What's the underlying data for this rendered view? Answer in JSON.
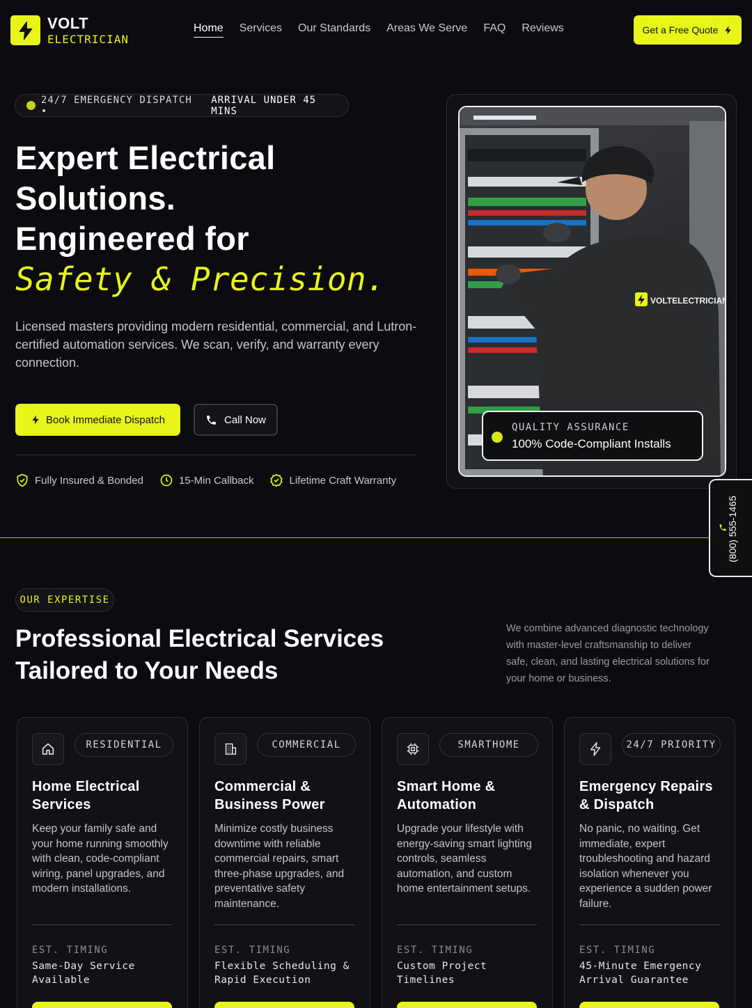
{
  "brand": {
    "name_top": "VOLT",
    "name_bottom": "ELECTRICIAN"
  },
  "nav": {
    "items": [
      {
        "label": "Home",
        "active": true
      },
      {
        "label": "Services"
      },
      {
        "label": "Our Standards"
      },
      {
        "label": "Areas We Serve"
      },
      {
        "label": "FAQ"
      },
      {
        "label": "Reviews"
      }
    ],
    "cta": "Get a Free Quote"
  },
  "hero": {
    "pill_a": "24/7 EMERGENCY DISPATCH •",
    "pill_b": "ARRIVAL UNDER 45 MINS",
    "title_1": "Expert Electrical",
    "title_2": "Solutions.",
    "title_3": "Engineered for",
    "title_4": "Safety & Precision.",
    "description": "Licensed masters providing modern residential, commercial, and Lutron-certified automation services. We scan, verify, and warranty every connection.",
    "primary_cta": "Book Immediate Dispatch",
    "secondary_cta": "Call Now",
    "badges": [
      "Fully Insured & Bonded",
      "15-Min Callback",
      "Lifetime Craft Warranty"
    ],
    "image_logo_text": "VOLTELECTRICIAN",
    "qa_label": "QUALITY ASSURANCE",
    "qa_text": "100% Code-Compliant Installs"
  },
  "side_phone": "(800) 555-1465",
  "services": {
    "pill": "OUR EXPERTISE",
    "title": "Professional Electrical Services Tailored to Your Needs",
    "description": "We combine advanced diagnostic technology with master-level craftsmanship to deliver safe, clean, and lasting electrical solutions for your home or business.",
    "timing_label": "EST. TIMING",
    "cards": [
      {
        "icon": "home-icon",
        "tag": "RESIDENTIAL",
        "title": "Home Electrical Services",
        "text": "Keep your family safe and your home running smoothly with clean, code-compliant wiring, panel upgrades, and modern installations.",
        "timing": "Same-Day Service Available"
      },
      {
        "icon": "building-icon",
        "tag": "COMMERCIAL",
        "title": "Commercial & Business Power",
        "text": "Minimize costly business downtime with reliable commercial repairs, smart three-phase upgrades, and preventative safety maintenance.",
        "timing": "Flexible Scheduling & Rapid Execution"
      },
      {
        "icon": "chip-icon",
        "tag": "SMARTHOME",
        "title": "Smart Home & Automation",
        "text": "Upgrade your lifestyle with energy-saving smart lighting controls, seamless automation, and custom home entertainment setups.",
        "timing": "Custom Project Timelines"
      },
      {
        "icon": "bolt-icon",
        "tag": "24/7 PRIORITY",
        "title": "Emergency Repairs & Dispatch",
        "text": "No panic, no waiting. Get immediate, expert troubleshooting and hazard isolation whenever you experience a sudden power failure.",
        "timing": "45-Minute Emergency Arrival Guarantee"
      }
    ]
  },
  "colors": {
    "accent": "#e8f51a",
    "background": "#0c0c10",
    "card": "#121216"
  }
}
